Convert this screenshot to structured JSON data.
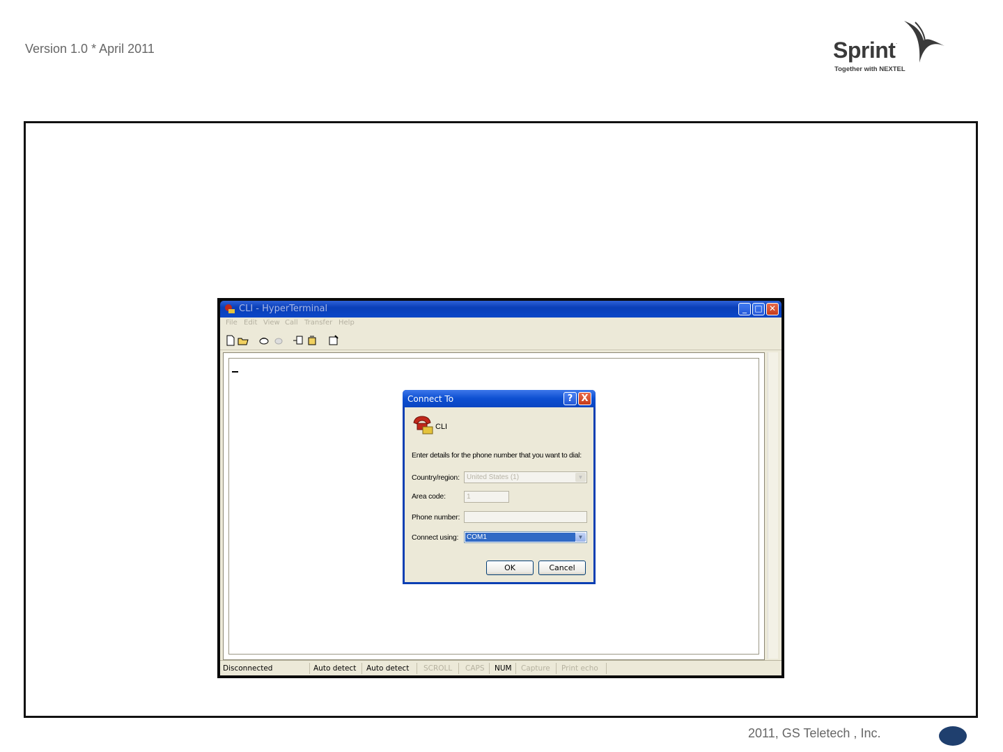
{
  "header": {
    "version": "Version 1.0 * April 2011"
  },
  "logo": {
    "word": "Sprint",
    "tm": ".",
    "tagline": "Together with NEXTEL"
  },
  "footer": {
    "copyright": "2011, GS Teletech , Inc."
  },
  "hyperterminal": {
    "title": "CLI - HyperTerminal",
    "menu": [
      "File",
      "Edit",
      "View",
      "Call",
      "Transfer",
      "Help"
    ],
    "toolbar_icons": [
      "new-icon",
      "open-icon",
      "dial-icon",
      "disconnect-icon",
      "send-icon",
      "receive-icon",
      "properties-icon"
    ],
    "status": {
      "connection": "Disconnected",
      "detect1": "Auto detect",
      "detect2": "Auto detect",
      "scroll": "SCROLL",
      "caps": "CAPS",
      "num": "NUM",
      "capture": "Capture",
      "print_echo": "Print echo"
    }
  },
  "dialog": {
    "title": "Connect To",
    "help": "?",
    "close": "X",
    "connection_name": "CLI",
    "description": "Enter details for the phone number that you want to dial:",
    "country_label": "Country/region:",
    "country_value": "United States (1)",
    "area_label": "Area code:",
    "area_value": "1",
    "phone_label": "Phone number:",
    "phone_value": "",
    "connect_label": "Connect using:",
    "connect_value": "COM1",
    "ok_label": "OK",
    "cancel_label": "Cancel"
  },
  "colors": {
    "title_bar_blue": "#0b46c8",
    "selection_blue": "#316ac5",
    "page_oval": "#1f3f6e"
  }
}
